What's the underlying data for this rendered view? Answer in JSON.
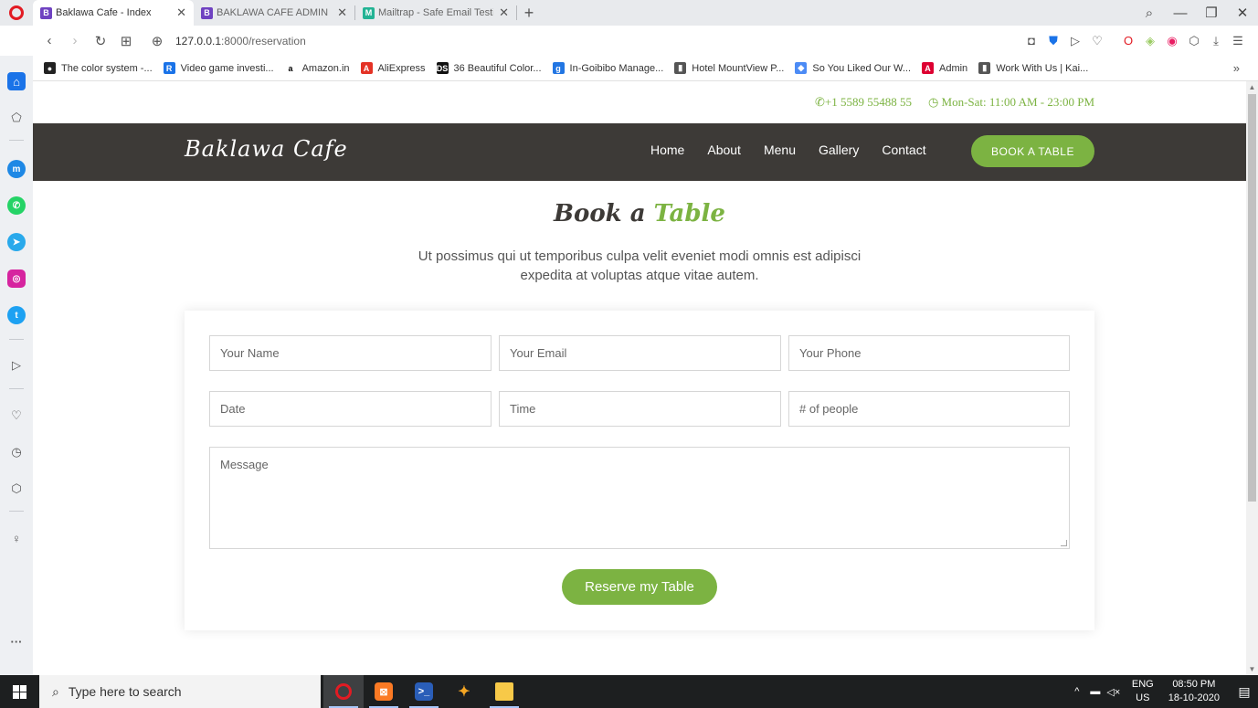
{
  "browser": {
    "tabs": [
      {
        "title": "Baklawa Cafe - Index",
        "favicon": "B",
        "active": true
      },
      {
        "title": "BAKLAWA CAFE ADMIN PA",
        "favicon": "B",
        "active": false
      },
      {
        "title": "Mailtrap - Safe Email Testin",
        "favicon": "M",
        "active": false
      }
    ],
    "url_host": "127.0.0.1",
    "url_path": ":8000/reservation",
    "bookmarks": [
      {
        "label": "The color system -...",
        "icon": "github-icon",
        "color": "#222222",
        "glyph": "●"
      },
      {
        "label": "Video game investi...",
        "icon": "bookmark-icon",
        "color": "#1a73e8",
        "glyph": "R"
      },
      {
        "label": "Amazon.in",
        "icon": "amazon-icon",
        "color": "#ffffff",
        "glyph": "a"
      },
      {
        "label": "AliExpress",
        "icon": "aliexpress-icon",
        "color": "#e43225",
        "glyph": "A"
      },
      {
        "label": "36 Beautiful Color...",
        "icon": "ds-icon",
        "color": "#111111",
        "glyph": "DS"
      },
      {
        "label": "In-Goibibo Manage...",
        "icon": "goibibo-icon",
        "color": "#2276e3",
        "glyph": "g"
      },
      {
        "label": "Hotel MountView P...",
        "icon": "page-icon",
        "color": "#555555",
        "glyph": "▮"
      },
      {
        "label": "So You Liked Our W...",
        "icon": "chat-icon",
        "color": "#4c8bf5",
        "glyph": "◆"
      },
      {
        "label": "Admin",
        "icon": "angular-icon",
        "color": "#dd0031",
        "glyph": "A"
      },
      {
        "label": "Work With Us | Kai...",
        "icon": "page-icon",
        "color": "#555555",
        "glyph": "▮"
      }
    ]
  },
  "site": {
    "phone": "+1 5589 55488 55",
    "hours": "Mon-Sat: 11:00 AM - 23:00 PM",
    "logo": "Baklawa Cafe",
    "menu": [
      "Home",
      "About",
      "Menu",
      "Gallery",
      "Contact"
    ],
    "cta": "BOOK A TABLE",
    "accent_color": "#7cb342",
    "nav_bg": "#3d3a37"
  },
  "reservation": {
    "heading_part1": "Book a",
    "heading_part2": "Table",
    "subtext": "Ut possimus qui ut temporibus culpa velit eveniet modi omnis est adipisci expedita at voluptas atque vitae autem.",
    "fields": {
      "name": "Your Name",
      "email": "Your Email",
      "phone": "Your Phone",
      "date": "Date",
      "time": "Time",
      "people": "# of people",
      "message": "Message"
    },
    "submit": "Reserve my Table"
  },
  "taskbar": {
    "search_placeholder": "Type here to search",
    "lang_top": "ENG",
    "lang_bottom": "US",
    "time": "08:50 PM",
    "date": "18-10-2020"
  }
}
